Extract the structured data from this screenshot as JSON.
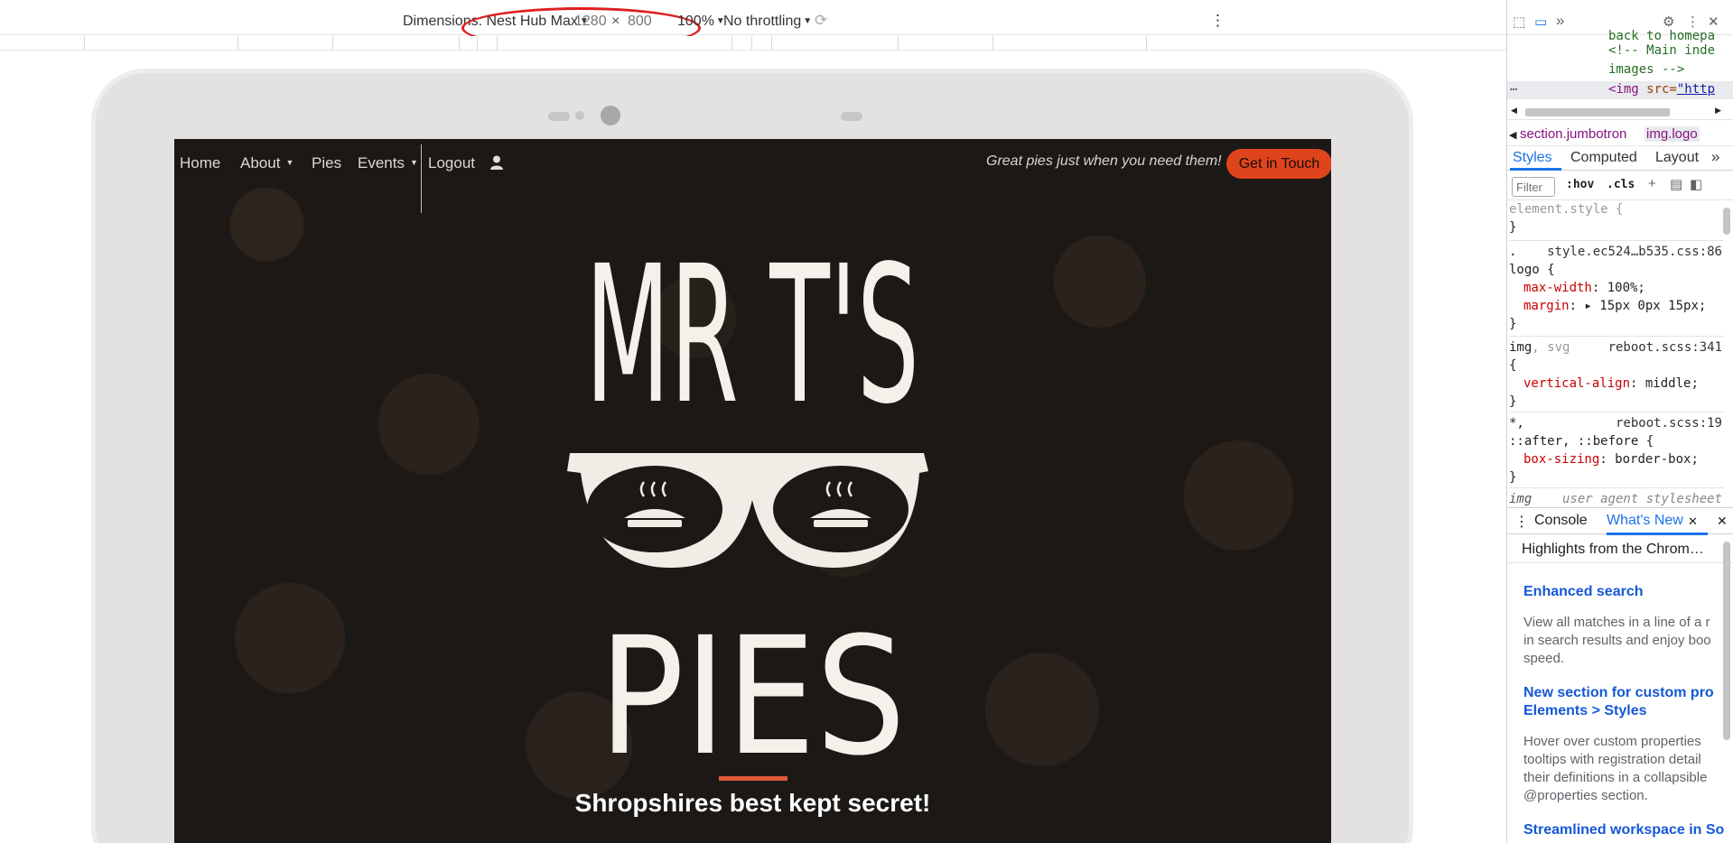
{
  "device_toolbar": {
    "dimensions_label": "Dimensions: Nest Hub Max",
    "width_value": "1280",
    "times_sign": "×",
    "height_value": "800",
    "zoom": "100%",
    "throttling": "No throttling",
    "highlight_color": "#e02020"
  },
  "site": {
    "nav": {
      "home": "Home",
      "about": "About",
      "pies": "Pies",
      "events": "Events",
      "logout": "Logout"
    },
    "tagline": "Great pies just when you need them!",
    "cta": "Get in Touch",
    "accent_color": "#e0441c",
    "logo_text": {
      "line1": "MR T'S",
      "line2": "PIES"
    },
    "hero_subtitle": "Shropshires best kept secret!"
  },
  "devtools": {
    "elements": {
      "line0": "back to homepa",
      "comment1": "<!-- Main inde",
      "comment2": "images -->",
      "img_tag": "<img",
      "img_attr": " src=",
      "img_value": "\"http"
    },
    "breadcrumbs": {
      "item1": "section.jumbotron",
      "item2": "img.logo"
    },
    "subtabs": {
      "styles": "Styles",
      "computed": "Computed",
      "layout": "Layout"
    },
    "filter_placeholder": "Filter",
    "hov": ":hov",
    "cls": ".cls",
    "rules": {
      "element_style": "element.style {",
      "close": "}",
      "logo_selector_a": ".",
      "logo_selector_b": "logo {",
      "logo_source": "style.ec524…b535.css:86",
      "logo_p1_name": "max-width",
      "logo_p1_value": ": 100%;",
      "logo_p2_name": "margin",
      "logo_p2_value": ": ▸ 15px 0px 15px;",
      "img_selector": "img",
      "img_selector_b": ", svg",
      "img_source": "reboot.scss:341",
      "img_open": "{",
      "img_p1_name": "vertical-align",
      "img_p1_value": ": middle;",
      "star_selector": "*,",
      "star_source": "reboot.scss:19",
      "star_selector_b": "::after, ::before {",
      "star_p1_name": "box-sizing",
      "star_p1_value": ": border-box;",
      "ua_selector": "img",
      "ua_source": "user agent stylesheet"
    },
    "drawer": {
      "console": "Console",
      "whats_new": "What's New"
    },
    "whats_new": {
      "header": "Highlights from the Chrom…",
      "item1_title": "Enhanced search",
      "item1_body_1": "View all matches in a line of a r",
      "item1_body_2": "in search results and enjoy boo",
      "item1_body_3": "speed.",
      "item2_title_1": "New section for custom pro",
      "item2_title_2": "Elements > Styles",
      "item2_body_1": "Hover over custom properties",
      "item2_body_2": "tooltips with registration detail",
      "item2_body_3": "their definitions in a collapsible",
      "item2_body_4": "@properties section.",
      "item3_title": "Streamlined workspace in So"
    },
    "accent_color": "#1a73e8"
  }
}
